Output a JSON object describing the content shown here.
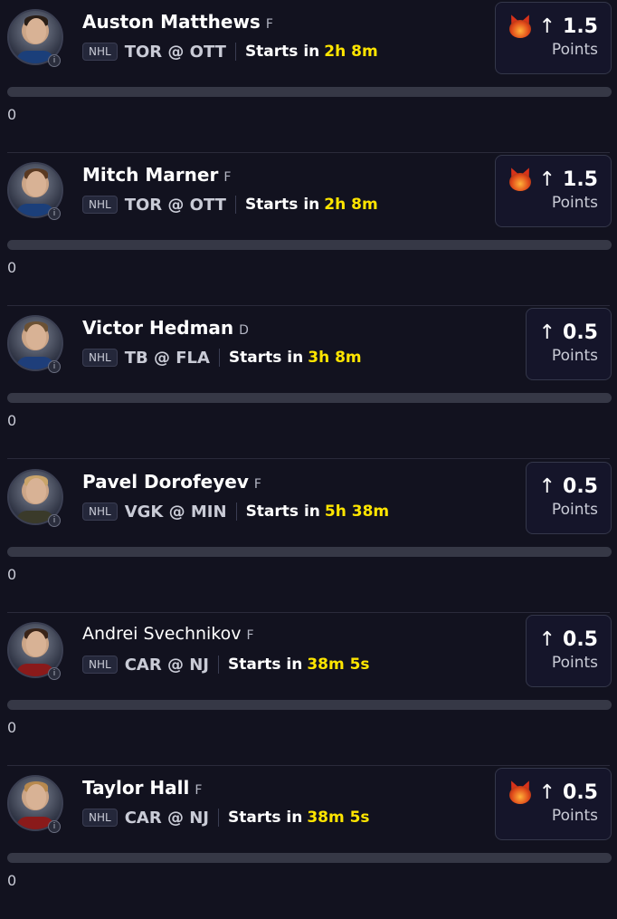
{
  "colors": {
    "background": "#12121f",
    "timer": "#ffe500",
    "card_border": "#34374a",
    "bar_track": "#363846"
  },
  "players": [
    {
      "name": "Auston Matthews",
      "position": "F",
      "league": "NHL",
      "matchup": "TOR @ OTT",
      "starts_label": "Starts in",
      "timer": "2h 8m",
      "demon": true,
      "arrow": "↑",
      "line": "1.5",
      "unit": "Points",
      "count": "0",
      "progress": 0,
      "jersey": "#1b3f7a",
      "hair": "#2a1e16",
      "avatar_icon": "player-avatar"
    },
    {
      "name": "Mitch Marner",
      "position": "F",
      "league": "NHL",
      "matchup": "TOR @ OTT",
      "starts_label": "Starts in",
      "timer": "2h 8m",
      "demon": true,
      "arrow": "↑",
      "line": "1.5",
      "unit": "Points",
      "count": "0",
      "progress": 0,
      "jersey": "#1b3f7a",
      "hair": "#5a3a22",
      "avatar_icon": "player-avatar"
    },
    {
      "name": "Victor Hedman",
      "position": "D",
      "league": "NHL",
      "matchup": "TB @ FLA",
      "starts_label": "Starts in",
      "timer": "3h 8m",
      "demon": false,
      "arrow": "↑",
      "line": "0.5",
      "unit": "Points",
      "count": "0",
      "progress": 0,
      "jersey": "#1e3e7a",
      "hair": "#6b5134",
      "avatar_icon": "player-avatar"
    },
    {
      "name": "Pavel Dorofeyev",
      "position": "F",
      "league": "NHL",
      "matchup": "VGK @ MIN",
      "starts_label": "Starts in",
      "timer": "5h 38m",
      "demon": false,
      "arrow": "↑",
      "line": "0.5",
      "unit": "Points",
      "count": "0",
      "progress": 0,
      "jersey": "#3a3a2a",
      "hair": "#c9a46a",
      "avatar_icon": "player-avatar"
    },
    {
      "name": "Andrei Svechnikov",
      "position": "F",
      "league": "NHL",
      "matchup": "CAR @ NJ",
      "starts_label": "Starts in",
      "timer": "38m 5s",
      "demon": false,
      "arrow": "↑",
      "line": "0.5",
      "unit": "Points",
      "count": "0",
      "progress": 0,
      "jersey": "#8a1a1a",
      "hair": "#3a2418",
      "avatar_icon": "player-avatar"
    },
    {
      "name": "Taylor Hall",
      "position": "F",
      "league": "NHL",
      "matchup": "CAR @ NJ",
      "starts_label": "Starts in",
      "timer": "38m 5s",
      "demon": true,
      "arrow": "↑",
      "line": "0.5",
      "unit": "Points",
      "count": "0",
      "progress": 0,
      "jersey": "#8a1a1a",
      "hair": "#b8894e",
      "avatar_icon": "player-avatar"
    }
  ]
}
